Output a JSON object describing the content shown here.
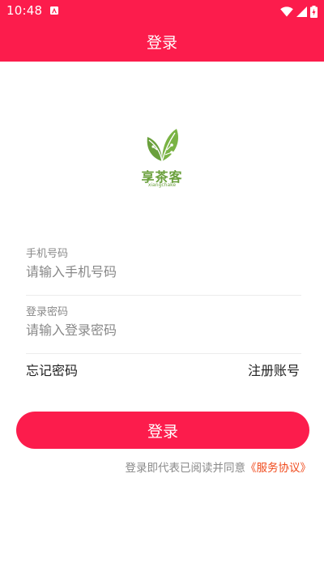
{
  "status_bar": {
    "time": "10:48",
    "icons": [
      "app-notification-icon",
      "wifi-icon",
      "signal-icon",
      "battery-icon"
    ]
  },
  "header": {
    "title": "登录"
  },
  "logo": {
    "name": "享茶客",
    "subtitle": "xiangchake",
    "color": "#6aa03c"
  },
  "form": {
    "phone": {
      "label": "手机号码",
      "placeholder": "请输入手机号码",
      "value": ""
    },
    "password": {
      "label": "登录密码",
      "placeholder": "请输入登录密码",
      "value": ""
    },
    "forgot_password": "忘记密码",
    "register": "注册账号",
    "login_button": "登录"
  },
  "agreement": {
    "text": "登录即代表已阅读并同意",
    "link": "《服务协议》"
  },
  "colors": {
    "brand": "#fc1c4c",
    "link": "#f04a1c"
  }
}
